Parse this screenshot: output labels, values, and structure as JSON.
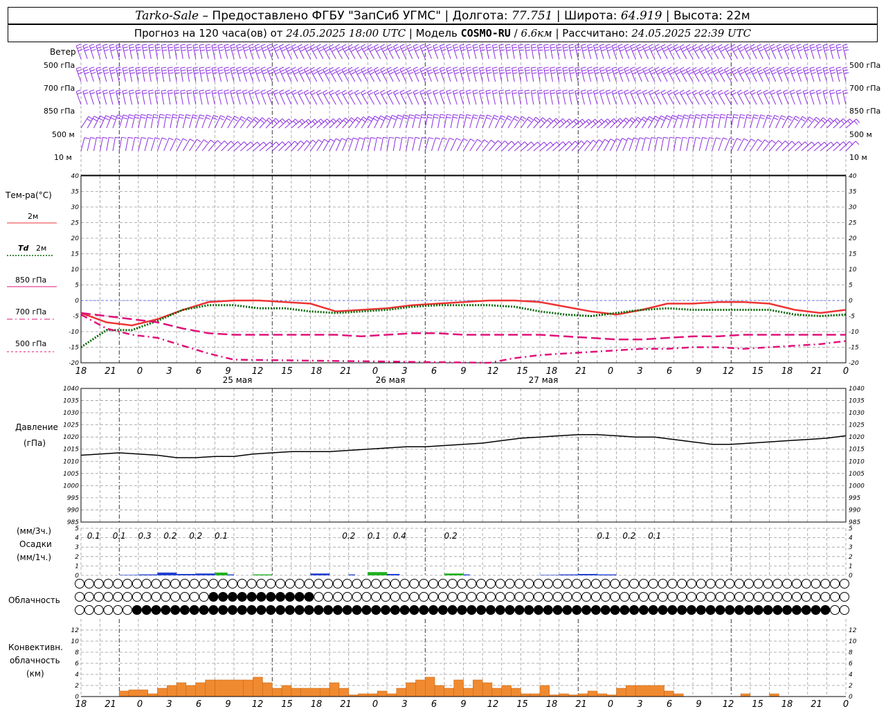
{
  "header": {
    "station": "Tarko-Sale",
    "provider": "– Предоставлено ФГБУ \"ЗапСиб УГМС\"",
    "lon_label": "Долгота:",
    "lon": "77.751",
    "lat_label": "Широта:",
    "lat": "64.919",
    "alt_label": "Высота:",
    "alt": "22м",
    "forecast_label": "Прогноз на 120 часа(ов) от",
    "forecast_time": "24.05.2025 18:00 UTC",
    "model_label": "Модель",
    "model": "COSMO-RU",
    "model_res": "6.6км",
    "calc_label": "Рассчитано:",
    "calc_time": "24.05.2025 22:39 UTC"
  },
  "labels": {
    "wind": "Ветер",
    "wind_levels": [
      "500 гПа",
      "700 гПа",
      "850 гПа",
      "500 м",
      "10  м"
    ],
    "temp": "Тем-ра(°C)",
    "t2m": "2м",
    "td": "Td",
    "td2m": "2м",
    "t850": "850 гПа",
    "t700": "700 гПа",
    "t500": "500 гПа",
    "pressure": "Давление",
    "pressure_unit": "(гПа)",
    "precip_unit1": "(мм/3ч.)",
    "precip": "Осадки",
    "precip_unit2": "(мм/1ч.)",
    "cloud": "Облачность",
    "conv1": "Конвективн.",
    "conv2": "облачность",
    "conv3": "(км)"
  },
  "colors": {
    "t2m": "#ee3333",
    "td": "#006600",
    "temp_levels": "#e0107a",
    "wind": "#8a2be2",
    "pressure": "#000000",
    "precip_blue": "#2040d0",
    "precip_green": "#20b020",
    "conv": "#f08a30"
  },
  "chart_data": [
    {
      "type": "line",
      "name": "temperature",
      "ylim": [
        -20,
        40
      ],
      "yticks": [
        -20,
        -15,
        -10,
        -5,
        0,
        5,
        10,
        15,
        20,
        25,
        30,
        35,
        40
      ],
      "x_ticks": [
        "18",
        "21",
        "0",
        "3",
        "6",
        "9",
        "12",
        "15",
        "18",
        "21",
        "0",
        "3",
        "6",
        "9",
        "12",
        "15",
        "18",
        "21",
        "0",
        "3",
        "6",
        "9",
        "12",
        "15",
        "18",
        "21",
        "0"
      ],
      "dates": [
        "25 мая",
        "26 мая",
        "27 мая"
      ],
      "x": [
        0,
        3,
        6,
        9,
        12,
        15,
        18,
        21,
        24,
        27,
        30,
        33,
        36,
        39,
        42,
        45,
        48,
        51,
        54,
        57,
        60,
        63,
        66,
        69,
        72,
        75,
        78,
        81,
        84,
        87,
        90,
        93,
        96,
        99,
        102,
        105,
        108,
        111,
        114,
        117,
        120
      ],
      "series": [
        {
          "name": "2м",
          "values": [
            -4,
            -7,
            -8,
            -6,
            -3,
            -0.5,
            0,
            0,
            -0.5,
            -1,
            -3.5,
            -3,
            -2.5,
            -1.5,
            -1,
            -0.5,
            0,
            0,
            -0.5,
            -2,
            -3.5,
            -4.5,
            -3,
            -1,
            -1,
            -0.5,
            -0.5,
            -1,
            -3,
            -4,
            -3
          ]
        },
        {
          "name": "Td 2м",
          "values": [
            -15,
            -9.5,
            -9.5,
            -6.5,
            -3,
            -1.5,
            -1.5,
            -2.5,
            -2.5,
            -3.5,
            -4,
            -3.5,
            -3,
            -2,
            -1.5,
            -1.5,
            -1.5,
            -2,
            -3.5,
            -4.5,
            -5,
            -4,
            -3,
            -2.5,
            -3,
            -3,
            -3,
            -3,
            -4.5,
            -5,
            -4.5
          ]
        },
        {
          "name": "850 гПа",
          "values": [
            -4,
            -5,
            -6,
            -7,
            -9,
            -10.5,
            -11,
            -11,
            -11,
            -11,
            -11,
            -11.5,
            -11,
            -10.5,
            -10.5,
            -11,
            -11,
            -11,
            -11,
            -11.5,
            -12,
            -12.5,
            -12.5,
            -12,
            -11.5,
            -11.5,
            -11,
            -11,
            -11,
            -11,
            -11
          ]
        },
        {
          "name": "700 гПа",
          "values": [
            -4.5,
            -9,
            -11,
            -12,
            -14.5,
            -17,
            -19,
            -20.5,
            -22,
            -23,
            -23,
            -23,
            -22.5,
            -22,
            -21.5,
            -21,
            -20,
            -18.5,
            -17.5,
            -17,
            -16.5,
            -16,
            -15.5,
            -15.5,
            -15,
            -15,
            -15.5,
            -15,
            -14.5,
            -14,
            -13
          ]
        },
        {
          "name": "500 гПа",
          "values": []
        }
      ]
    },
    {
      "type": "line",
      "name": "pressure",
      "ylim": [
        985,
        1040
      ],
      "yticks": [
        985,
        990,
        995,
        1000,
        1005,
        1010,
        1015,
        1020,
        1025,
        1030,
        1035,
        1040
      ],
      "x": [
        0,
        3,
        6,
        9,
        12,
        15,
        18,
        21,
        24,
        27,
        30,
        33,
        36,
        39,
        42,
        45,
        48,
        51,
        54,
        57,
        60,
        63,
        66,
        69,
        72,
        75,
        78,
        81,
        84,
        87,
        90,
        93,
        96,
        99,
        102,
        105,
        108,
        111,
        114,
        117,
        120
      ],
      "series": [
        {
          "name": "Давление",
          "values": [
            1012.5,
            1013,
            1013.5,
            1013,
            1012.5,
            1011.5,
            1011.5,
            1012,
            1012,
            1013,
            1013.5,
            1014,
            1014,
            1014,
            1014.5,
            1015,
            1015.5,
            1016,
            1016,
            1016.5,
            1017,
            1017.5,
            1018.5,
            1019.5,
            1020,
            1020.5,
            1021,
            1021,
            1020.5,
            1020,
            1020,
            1019,
            1018,
            1017,
            1017,
            1017.5,
            1018,
            1018.5,
            1019,
            1019.5,
            1020.5
          ]
        }
      ]
    },
    {
      "type": "bar",
      "name": "precipitation",
      "ylim": [
        0,
        5
      ],
      "yticks": [
        0,
        1,
        2,
        3,
        4,
        5
      ],
      "labels_3h": [
        "0.1",
        "0.1",
        "0.3",
        "0.2",
        "0.2",
        "0.1",
        "0.2",
        "0.1",
        "0.4",
        "0.2",
        "0.1",
        "0.2",
        "0.1"
      ],
      "labels_3h_x": [
        21,
        27,
        33,
        39,
        45,
        51,
        81,
        87,
        93,
        105,
        141,
        147,
        153
      ],
      "series": [
        {
          "name": "мм/1ч",
          "values": [
            0,
            0,
            0,
            0,
            0,
            0,
            0,
            0,
            0,
            0,
            0,
            0,
            0,
            0,
            0,
            0,
            0,
            0,
            0,
            0,
            0,
            0,
            0,
            0,
            0,
            0,
            0,
            0,
            0,
            0,
            0,
            0,
            0,
            0,
            0,
            0,
            0,
            0,
            0,
            0,
            0,
            0,
            0,
            0,
            0,
            0,
            0,
            0,
            0,
            0,
            0,
            0,
            0,
            0,
            0,
            0,
            0,
            0,
            0,
            0,
            0,
            0,
            0,
            0,
            0,
            0,
            0,
            0,
            0,
            0,
            0,
            0,
            0,
            0,
            0,
            0,
            0,
            0,
            0,
            0,
            0,
            0,
            0,
            0,
            0,
            0,
            0,
            0,
            0,
            0,
            0,
            0,
            0,
            0,
            0,
            0,
            0,
            0,
            0,
            0,
            0,
            0,
            0,
            0,
            0,
            0,
            0,
            0,
            0,
            0,
            0,
            0,
            0,
            0,
            0,
            0,
            0,
            0,
            0,
            0,
            0
          ]
        }
      ],
      "bars": [
        {
          "from": 6,
          "to": 9,
          "value": 0.05,
          "color": "blue"
        },
        {
          "from": 9,
          "to": 12,
          "value": 0.1,
          "color": "blue"
        },
        {
          "from": 12,
          "to": 15,
          "value": 0.3,
          "color": "blue"
        },
        {
          "from": 15,
          "to": 18,
          "value": 0.15,
          "color": "blue"
        },
        {
          "from": 18,
          "to": 21,
          "value": 0.2,
          "color": "blue"
        },
        {
          "from": 21,
          "to": 23,
          "value": 0.3,
          "color": "green"
        },
        {
          "from": 23,
          "to": 24,
          "value": 0.1,
          "color": "blue"
        },
        {
          "from": 27,
          "to": 30,
          "value": 0.1,
          "color": "green"
        },
        {
          "from": 36,
          "to": 39,
          "value": 0.2,
          "color": "blue"
        },
        {
          "from": 42,
          "to": 43,
          "value": 0.1,
          "color": "blue"
        },
        {
          "from": 45,
          "to": 48,
          "value": 0.35,
          "color": "green"
        },
        {
          "from": 48,
          "to": 50,
          "value": 0.15,
          "color": "blue"
        },
        {
          "from": 57,
          "to": 60,
          "value": 0.2,
          "color": "green"
        },
        {
          "from": 60,
          "to": 61,
          "value": 0.1,
          "color": "blue"
        },
        {
          "from": 72,
          "to": 75,
          "value": 0.05,
          "color": "blue"
        },
        {
          "from": 75,
          "to": 78,
          "value": 0.1,
          "color": "blue"
        },
        {
          "from": 78,
          "to": 81,
          "value": 0.15,
          "color": "blue"
        },
        {
          "from": 81,
          "to": 84,
          "value": 0.1,
          "color": "blue"
        }
      ]
    },
    {
      "type": "bar",
      "name": "convective_cloud",
      "ylim": [
        0,
        14
      ],
      "yticks": [
        0,
        2,
        4,
        6,
        8,
        10,
        12
      ],
      "bars": [
        {
          "from": 0,
          "to": 1,
          "value": 1
        },
        {
          "from": 1,
          "to": 3,
          "value": 1.2
        },
        {
          "from": 3,
          "to": 4,
          "value": 0.5
        },
        {
          "from": 4,
          "to": 5,
          "value": 1.5
        },
        {
          "from": 5,
          "to": 6,
          "value": 2
        },
        {
          "from": 6,
          "to": 7,
          "value": 2.5
        },
        {
          "from": 7,
          "to": 8,
          "value": 2
        },
        {
          "from": 8,
          "to": 9,
          "value": 2.5
        },
        {
          "from": 9,
          "to": 10,
          "value": 3
        },
        {
          "from": 10,
          "to": 13,
          "value": 3
        },
        {
          "from": 13,
          "to": 14,
          "value": 3
        },
        {
          "from": 14,
          "to": 15,
          "value": 3.5
        },
        {
          "from": 15,
          "to": 16,
          "value": 2.5
        },
        {
          "from": 16,
          "to": 17,
          "value": 1.5
        },
        {
          "from": 17,
          "to": 18,
          "value": 2
        },
        {
          "from": 18,
          "to": 19,
          "value": 1.5
        },
        {
          "from": 19,
          "to": 21,
          "value": 1.5
        },
        {
          "from": 21,
          "to": 22,
          "value": 1.5
        },
        {
          "from": 22,
          "to": 23,
          "value": 2.5
        },
        {
          "from": 23,
          "to": 24,
          "value": 1.5
        },
        {
          "from": 24,
          "to": 25,
          "value": 0.3
        },
        {
          "from": 25,
          "to": 26,
          "value": 0.5
        },
        {
          "from": 26,
          "to": 27,
          "value": 0.5
        },
        {
          "from": 27,
          "to": 28,
          "value": 1
        },
        {
          "from": 28,
          "to": 29,
          "value": 0.5
        },
        {
          "from": 29,
          "to": 30,
          "value": 1.5
        },
        {
          "from": 30,
          "to": 31,
          "value": 2.5
        },
        {
          "from": 31,
          "to": 32,
          "value": 3
        },
        {
          "from": 32,
          "to": 33,
          "value": 3.5
        },
        {
          "from": 33,
          "to": 34,
          "value": 2
        },
        {
          "from": 34,
          "to": 35,
          "value": 1.5
        },
        {
          "from": 35,
          "to": 36,
          "value": 3
        },
        {
          "from": 36,
          "to": 37,
          "value": 1.5
        },
        {
          "from": 37,
          "to": 38,
          "value": 3
        },
        {
          "from": 38,
          "to": 39,
          "value": 2.5
        },
        {
          "from": 39,
          "to": 40,
          "value": 1.5
        },
        {
          "from": 40,
          "to": 41,
          "value": 2
        },
        {
          "from": 41,
          "to": 42,
          "value": 1.5
        },
        {
          "from": 42,
          "to": 43,
          "value": 0.5
        },
        {
          "from": 43,
          "to": 44,
          "value": 0.5
        },
        {
          "from": 44,
          "to": 45,
          "value": 2
        },
        {
          "from": 45,
          "to": 46,
          "value": 0.3
        },
        {
          "from": 46,
          "to": 47,
          "value": 0.5
        },
        {
          "from": 47,
          "to": 48,
          "value": 0.3
        },
        {
          "from": 48,
          "to": 49,
          "value": 0.5
        },
        {
          "from": 49,
          "to": 50,
          "value": 1
        },
        {
          "from": 50,
          "to": 51,
          "value": 0.5
        },
        {
          "from": 51,
          "to": 52,
          "value": 0.3
        },
        {
          "from": 52,
          "to": 53,
          "value": 1.5
        },
        {
          "from": 53,
          "to": 54,
          "value": 2
        },
        {
          "from": 54,
          "to": 57,
          "value": 2
        },
        {
          "from": 57,
          "to": 58,
          "value": 1
        },
        {
          "from": 58,
          "to": 59,
          "value": 0.5
        },
        {
          "from": 59,
          "to": 60,
          "value": 0
        },
        {
          "from": 60,
          "to": 61,
          "value": 0
        },
        {
          "from": 61,
          "to": 62,
          "value": 0
        },
        {
          "from": 62,
          "to": 63,
          "value": 0
        },
        {
          "from": 63,
          "to": 64,
          "value": 0
        },
        {
          "from": 64,
          "to": 65,
          "value": 0
        },
        {
          "from": 65,
          "to": 66,
          "value": 0.5
        },
        {
          "from": 66,
          "to": 67,
          "value": 0
        },
        {
          "from": 67,
          "to": 68,
          "value": 0
        },
        {
          "from": 68,
          "to": 69,
          "value": 0.5
        },
        {
          "from": 69,
          "to": 70,
          "value": 0
        },
        {
          "from": 70,
          "to": 71,
          "value": 0
        },
        {
          "from": 71,
          "to": 72,
          "value": 0
        },
        {
          "from": 72,
          "to": 73,
          "value": 0
        },
        {
          "from": 73,
          "to": 74,
          "value": 0
        },
        {
          "from": 74,
          "to": 75,
          "value": 0
        },
        {
          "from": 75,
          "to": 76,
          "value": 0
        }
      ]
    }
  ]
}
